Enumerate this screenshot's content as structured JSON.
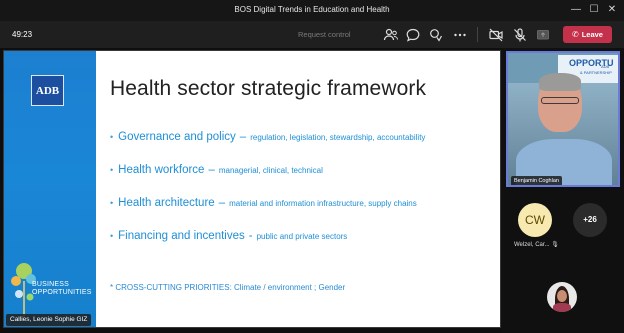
{
  "window": {
    "title": "BOS Digital Trends in Education and Health"
  },
  "toolbar": {
    "timer": "49:23",
    "request_control": "Request control",
    "leave_label": "Leave"
  },
  "slide": {
    "logo": "ADB",
    "title": "Health sector strategic framework",
    "bullets": [
      {
        "head": "Governance and policy",
        "sub": "regulation, legislation, stewardship, accountability",
        "dash": "–"
      },
      {
        "head": "Health workforce",
        "sub": "managerial, clinical, technical",
        "dash": "–"
      },
      {
        "head": "Health architecture",
        "sub": "material and information infrastructure, supply chains",
        "dash": "–"
      },
      {
        "head": "Financing and incentives",
        "sub": "public and private sectors",
        "dash": "-"
      }
    ],
    "cross_cutting": "* CROSS-CUTTING PRIORITIES: Climate / environment ; Gender",
    "bo_line1": "BUSINESS",
    "bo_line2": "OPPORTUNITIES"
  },
  "presenter_tag": "Callies, Leonie Sophie GIZ",
  "participants": {
    "video_name": "Benjamin Coghlan",
    "video_banner": "OPPORTU",
    "video_banner_small": "ADB",
    "video_banner_sub": "& PARTNERSHIP",
    "cw_initials": "CW",
    "cw_name": "Welzel, Car...",
    "more_count": "+26"
  },
  "colors": {
    "leave": "#c4314b",
    "slide_blue": "#1a86d6",
    "text_blue": "#1e8fd6"
  }
}
